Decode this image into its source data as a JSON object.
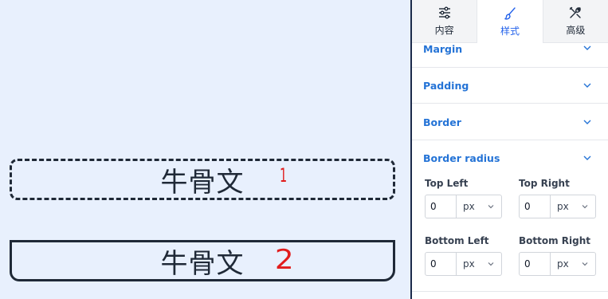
{
  "canvas": {
    "box1_text": "牛骨文",
    "box1_mark": "1",
    "box2_text": "牛骨文",
    "box2_mark": "2"
  },
  "tabs": [
    {
      "label": "内容",
      "icon": "sliders-icon",
      "active": false
    },
    {
      "label": "样式",
      "icon": "brush-icon",
      "active": true
    },
    {
      "label": "高级",
      "icon": "tools-icon",
      "active": false
    }
  ],
  "sections": {
    "margin": "Margin",
    "padding": "Padding",
    "border": "Border",
    "border_radius": "Border radius"
  },
  "border_radius": {
    "top_left": {
      "label": "Top Left",
      "value": "0",
      "unit": "px"
    },
    "top_right": {
      "label": "Top Right",
      "value": "0",
      "unit": "px"
    },
    "bottom_left": {
      "label": "Bottom Left",
      "value": "0",
      "unit": "px"
    },
    "bottom_right": {
      "label": "Bottom Right",
      "value": "0",
      "unit": "px"
    }
  },
  "colors": {
    "canvas_bg": "#e8f0fd",
    "accent": "#2563eb",
    "section_title": "#2473d6",
    "annotation": "#e11d1d"
  }
}
